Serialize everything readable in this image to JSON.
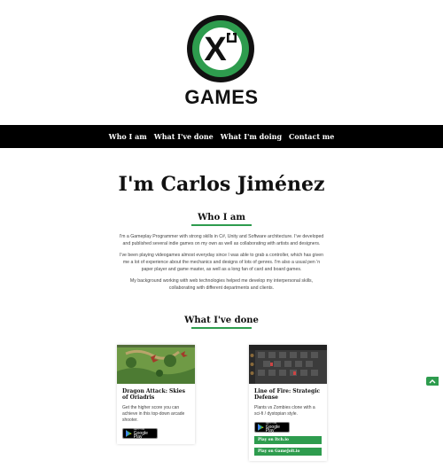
{
  "brand": {
    "logo_letter": "X",
    "logo_word": "GAMES",
    "accent_color": "#2e9c4e"
  },
  "nav": {
    "items": [
      {
        "label": "Who I am"
      },
      {
        "label": "What I've done"
      },
      {
        "label": "What I'm doing"
      },
      {
        "label": "Contact me"
      }
    ]
  },
  "hero": {
    "title": "I'm Carlos Jiménez"
  },
  "about": {
    "title": "Who I am",
    "paragraphs": [
      "I'm a Gameplay Programmer with strong skills in C#, Unity and Software architecture. I've developed and published several indie games on my own as well as collaborating with artists and designers.",
      "I've been playing videogames almost everyday since I was able to grab a controller, which has given me a lot of experience about the mechanics and designs of lots of genres. I'm also a usual pen 'n paper player and game master, as well as a long fan of card and board games.",
      "My background working with web technologies helped me develop my interpersonal skills, collaborating with different departments and clients."
    ]
  },
  "work": {
    "title": "What I've done",
    "projects": [
      {
        "title": "Dragon Attack: Skies of Oriadris",
        "description": "Get the higher score you can achieve in this top-down arcade shooter.",
        "store_small": "GET IT ON",
        "store_big": "Google Play",
        "links": []
      },
      {
        "title": "Line of Fire: Strategic Defense",
        "description": "Plants vs Zombies clone with a sci-fi / dystopian style.",
        "store_small": "GET IT ON",
        "store_big": "Google Play",
        "links": [
          {
            "label": "Play on Itch.io"
          },
          {
            "label": "Play on GameJolt.io"
          }
        ]
      }
    ]
  }
}
